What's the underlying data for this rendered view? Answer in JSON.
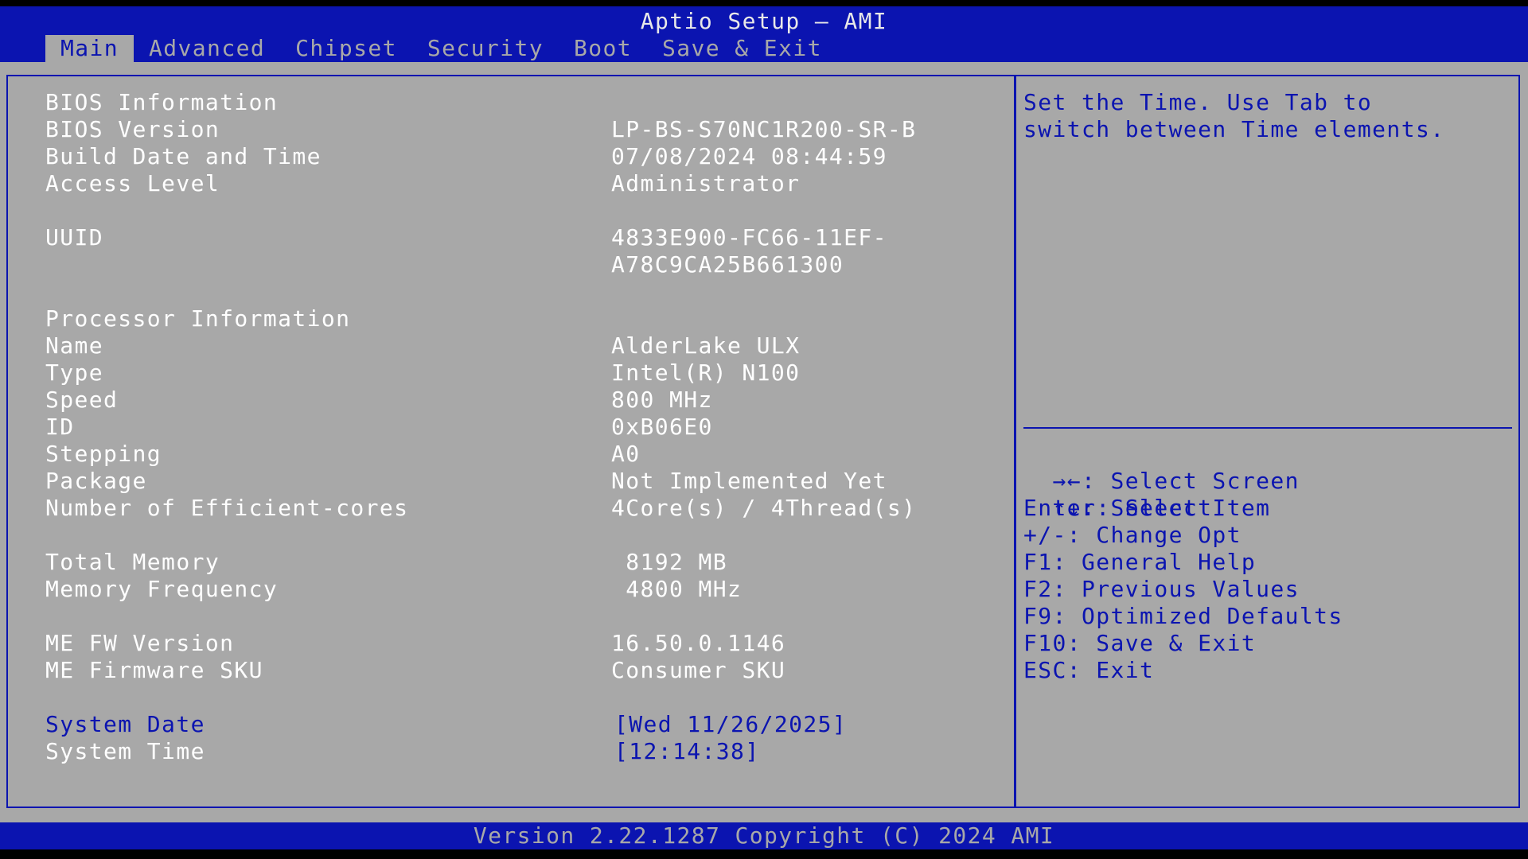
{
  "header": {
    "title": "Aptio Setup – AMI",
    "tabs": [
      {
        "label": "Main"
      },
      {
        "label": "Advanced"
      },
      {
        "label": "Chipset"
      },
      {
        "label": "Security"
      },
      {
        "label": "Boot"
      },
      {
        "label": "Save & Exit"
      }
    ],
    "active_tab": "Main"
  },
  "main": {
    "bios_info_heading": "BIOS Information",
    "bios_version_label": "BIOS Version",
    "bios_version_value": "LP-BS-S70NC1R200-SR-B",
    "build_date_label": "Build Date and Time",
    "build_date_value": "07/08/2024 08:44:59",
    "access_level_label": "Access Level",
    "access_level_value": "Administrator",
    "uuid_label": "UUID",
    "uuid_value_line1": "4833E900-FC66-11EF-",
    "uuid_value_line2": "A78C9CA25B661300",
    "processor_heading": "Processor Information",
    "name_label": "Name",
    "name_value": "AlderLake ULX",
    "type_label": "Type",
    "type_value": "Intel(R) N100",
    "speed_label": "Speed",
    "speed_value": "800 MHz",
    "id_label": "ID",
    "id_value": "0xB06E0",
    "stepping_label": "Stepping",
    "stepping_value": "A0",
    "package_label": "Package",
    "package_value": "Not Implemented Yet",
    "ecores_label": "Number of Efficient-cores",
    "ecores_value": "4Core(s) / 4Thread(s)",
    "total_memory_label": "Total Memory",
    "total_memory_value": " 8192 MB",
    "memory_freq_label": "Memory Frequency",
    "memory_freq_value": " 4800 MHz",
    "me_fw_label": "ME FW Version",
    "me_fw_value": "16.50.0.1146",
    "me_sku_label": "ME Firmware SKU",
    "me_sku_value": "Consumer SKU",
    "system_date_label": "System Date",
    "system_date_value": "[Wed 11/26/2025]",
    "system_time_label": "System Time",
    "system_time_value": "[12:14:38]"
  },
  "help": {
    "line1": "Set the Time. Use Tab to",
    "line2": "switch between Time elements."
  },
  "keys": {
    "select_screen": ": Select Screen",
    "select_item": ": Select Item",
    "enter": "Enter: Select",
    "change_opt": "+/-: Change Opt",
    "f1": "F1: General Help",
    "f2": "F2: Previous Values",
    "f9": "F9: Optimized Defaults",
    "f10": "F10: Save & Exit",
    "esc": "ESC: Exit",
    "lr_arrows": "→←",
    "ud_arrows": "↑↓"
  },
  "footer": {
    "version": "Version 2.22.1287 Copyright (C) 2024 AMI"
  },
  "colors": {
    "bios_blue": "#0b14b0",
    "bios_gray": "#a8a8a8",
    "text_white": "#ffffff"
  }
}
